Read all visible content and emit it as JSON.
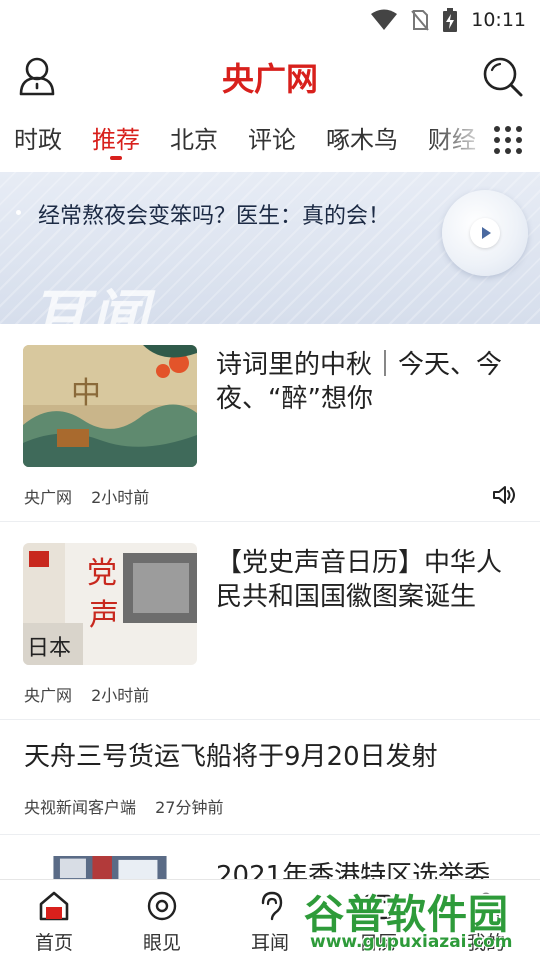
{
  "status_bar": {
    "time": "10:11",
    "icons": [
      "wifi-icon",
      "no-sim-icon",
      "battery-charging-icon"
    ]
  },
  "header": {
    "logo": "央广网",
    "left_icon": "user-icon",
    "right_icon": "search-icon"
  },
  "tabs": {
    "items": [
      "时政",
      "推荐",
      "北京",
      "评论",
      "啄木鸟",
      "财经"
    ],
    "active_index": 1,
    "accent_color": "#d8201c",
    "more_icon": "grid-icon"
  },
  "banner": {
    "headline": "经常熬夜会变笨吗？医生：真的会！",
    "watermark": "耳闻",
    "play_icon": "play-icon"
  },
  "news": [
    {
      "title": "诗词里的中秋｜今天、今夜、“醉”想你",
      "source": "央广网",
      "time": "2小时前",
      "has_audio": true
    },
    {
      "title": "【党史声音日历】中华人民共和国国徽图案诞生",
      "source": "央广网",
      "time": "2小时前",
      "has_audio": false
    },
    {
      "title": "天舟三号货运飞船将于9月20日发射",
      "source": "央视新闻客户端",
      "time": "27分钟前",
      "has_audio": false
    },
    {
      "title": "2021年香港特区选举委",
      "source": "",
      "time": "",
      "has_audio": false
    }
  ],
  "bottom_nav": {
    "items": [
      {
        "label": "首页",
        "icon": "home-icon"
      },
      {
        "label": "眼见",
        "icon": "eye-icon"
      },
      {
        "label": "耳闻",
        "icon": "ear-icon"
      },
      {
        "label": "日历",
        "icon": "calendar-icon"
      },
      {
        "label": "我的",
        "icon": "profile-icon"
      }
    ],
    "active_index": 0
  },
  "site_watermark": {
    "name": "谷普软件园",
    "url": "www.gupuxiazai.com"
  }
}
